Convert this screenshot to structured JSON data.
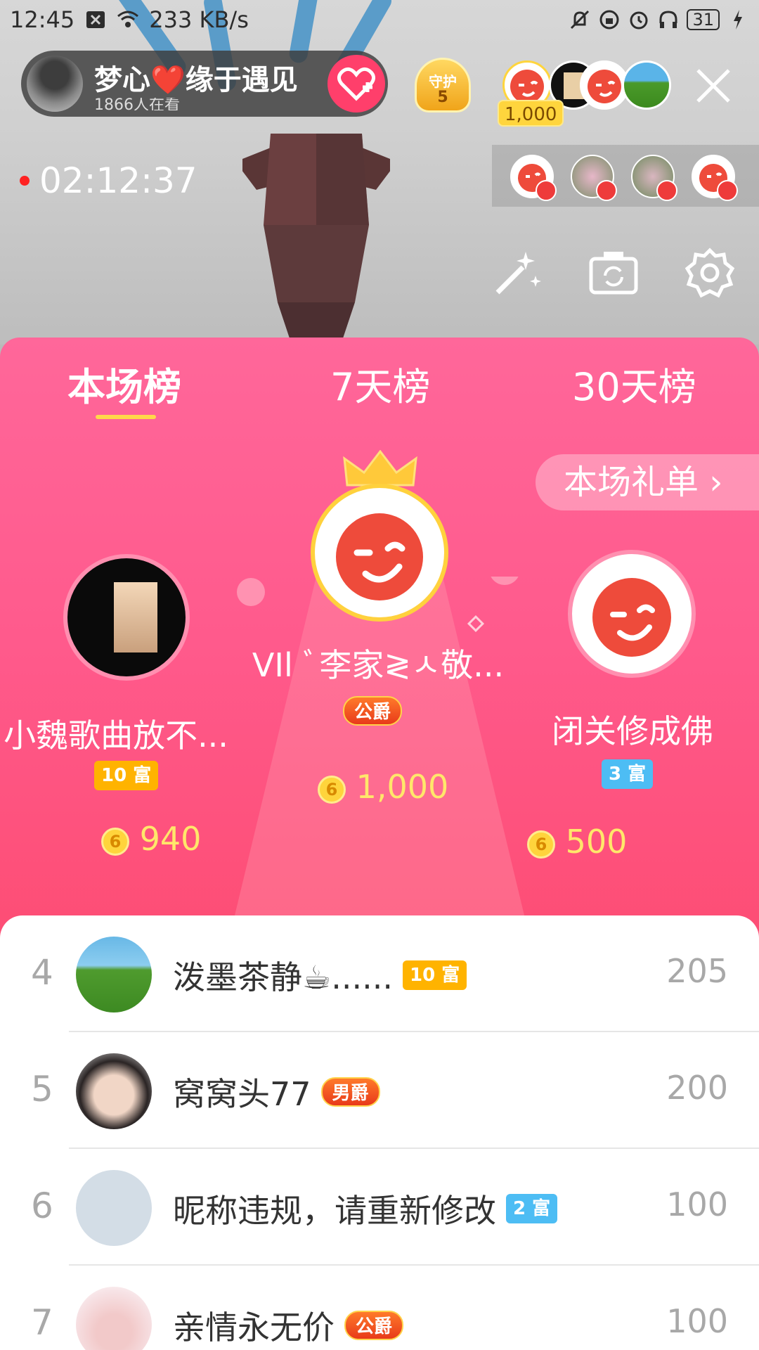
{
  "status_bar": {
    "time": "12:45",
    "network_speed": "233 KB/s",
    "battery": "31"
  },
  "host": {
    "name": "梦心❤️缘于遇见",
    "viewers": "1866人在看"
  },
  "guard": {
    "label": "守护",
    "level": "5"
  },
  "top_viewer_badge": "1,000",
  "live_timer": "02:12:37",
  "tabs": [
    {
      "label": "本场榜",
      "active": true
    },
    {
      "label": "7天榜",
      "active": false
    },
    {
      "label": "30天榜",
      "active": false
    }
  ],
  "gift_list_button": "本场礼单 ›",
  "podium": {
    "first": {
      "name": "VIl ﾞ李家≷ㅅ敬...",
      "badge": "公爵",
      "value": "1,000"
    },
    "second": {
      "name": "小魏歌曲放不...",
      "badge": "10 富",
      "value": "940"
    },
    "third": {
      "name": "闭关修成佛",
      "badge": "3 富",
      "value": "500"
    },
    "coin_symbol": "6"
  },
  "list": [
    {
      "rank": "4",
      "name": "泼墨茶静☕......",
      "badge": "10 富",
      "badge_type": "rich-gold",
      "value": "205"
    },
    {
      "rank": "5",
      "name": "窝窝头77",
      "badge": "男爵",
      "badge_type": "noble",
      "value": "200"
    },
    {
      "rank": "6",
      "name": "昵称违规，请重新修改",
      "badge": "2 富",
      "badge_type": "rich-blue",
      "value": "100"
    },
    {
      "rank": "7",
      "name": "亲情永无价",
      "badge": "公爵",
      "badge_type": "noble",
      "value": "100"
    }
  ],
  "colors": {
    "panel_pink": "#ff5a8c",
    "accent_yellow": "#ffd84a",
    "follow_red": "#ff3f6b"
  }
}
